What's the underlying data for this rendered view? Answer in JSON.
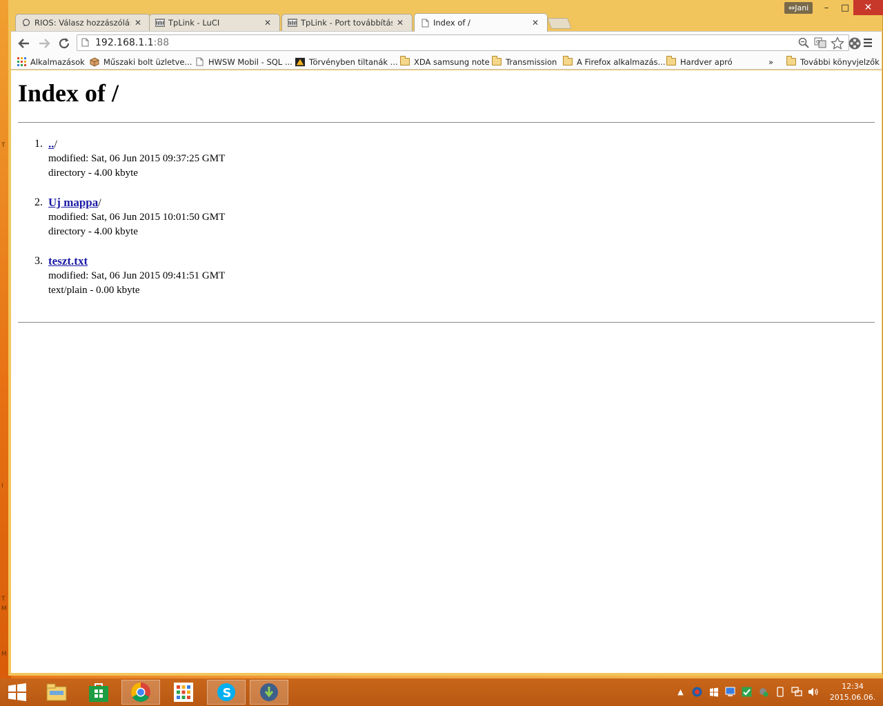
{
  "window": {
    "user_name": "Jani",
    "controls": {
      "minimize": "–",
      "maximize": "□",
      "close": "✕"
    }
  },
  "tabs": [
    {
      "title": "RIOS: Válasz hozzászólás ír",
      "icon": "chat-bubble-icon",
      "active": false
    },
    {
      "title": "TpLink - LuCI",
      "icon": "luci-logo-icon",
      "active": false
    },
    {
      "title": "TpLink - Port továbbítás - ",
      "icon": "luci-logo-icon",
      "active": false
    },
    {
      "title": "Index of /",
      "icon": "page-icon",
      "active": true
    }
  ],
  "toolbar": {
    "url_host": "192.168.1.1",
    "url_port": ":88"
  },
  "bookmarks": {
    "items": [
      {
        "label": "Alkalmazások",
        "icon": "apps-grid-icon"
      },
      {
        "label": "Műszaki bolt üzletve...",
        "icon": "box-icon"
      },
      {
        "label": "HWSW Mobil - SQL ...",
        "icon": "page-icon"
      },
      {
        "label": "Törvényben tiltanák ...",
        "icon": "site-logo-icon"
      },
      {
        "label": "XDA samsung note",
        "icon": "folder-icon"
      },
      {
        "label": "Transmission",
        "icon": "folder-icon"
      },
      {
        "label": "A Firefox alkalmazás...",
        "icon": "folder-icon"
      },
      {
        "label": "Hardver apró",
        "icon": "folder-icon"
      }
    ],
    "overflow": "»",
    "other_label": "További könyvjelzők"
  },
  "page": {
    "heading": "Index of /",
    "entries": [
      {
        "number": "1.",
        "name": "..",
        "suffix": "/",
        "modified": "modified: Sat, 06 Jun 2015 09:37:25 GMT",
        "info": "directory - 4.00 kbyte"
      },
      {
        "number": "2.",
        "name": "Uj mappa",
        "suffix": "/",
        "modified": "modified: Sat, 06 Jun 2015 10:01:50 GMT",
        "info": "directory - 4.00 kbyte"
      },
      {
        "number": "3.",
        "name": "teszt.txt",
        "suffix": "",
        "modified": "modified: Sat, 06 Jun 2015 09:41:51 GMT",
        "info": "text/plain - 0.00 kbyte"
      }
    ]
  },
  "taskbar": {
    "apps": [
      {
        "name": "file-explorer-icon"
      },
      {
        "name": "store-icon"
      },
      {
        "name": "chrome-icon",
        "active": true
      },
      {
        "name": "start-apps-icon"
      },
      {
        "name": "skype-icon"
      },
      {
        "name": "downloader-icon"
      }
    ],
    "clock_time": "12:34",
    "clock_date": "2015.06.06."
  },
  "colors": {
    "link": "#1a1aa6",
    "taskbar": "#c9661a",
    "frame": "#f2c55c",
    "close_button": "#c7382a"
  }
}
